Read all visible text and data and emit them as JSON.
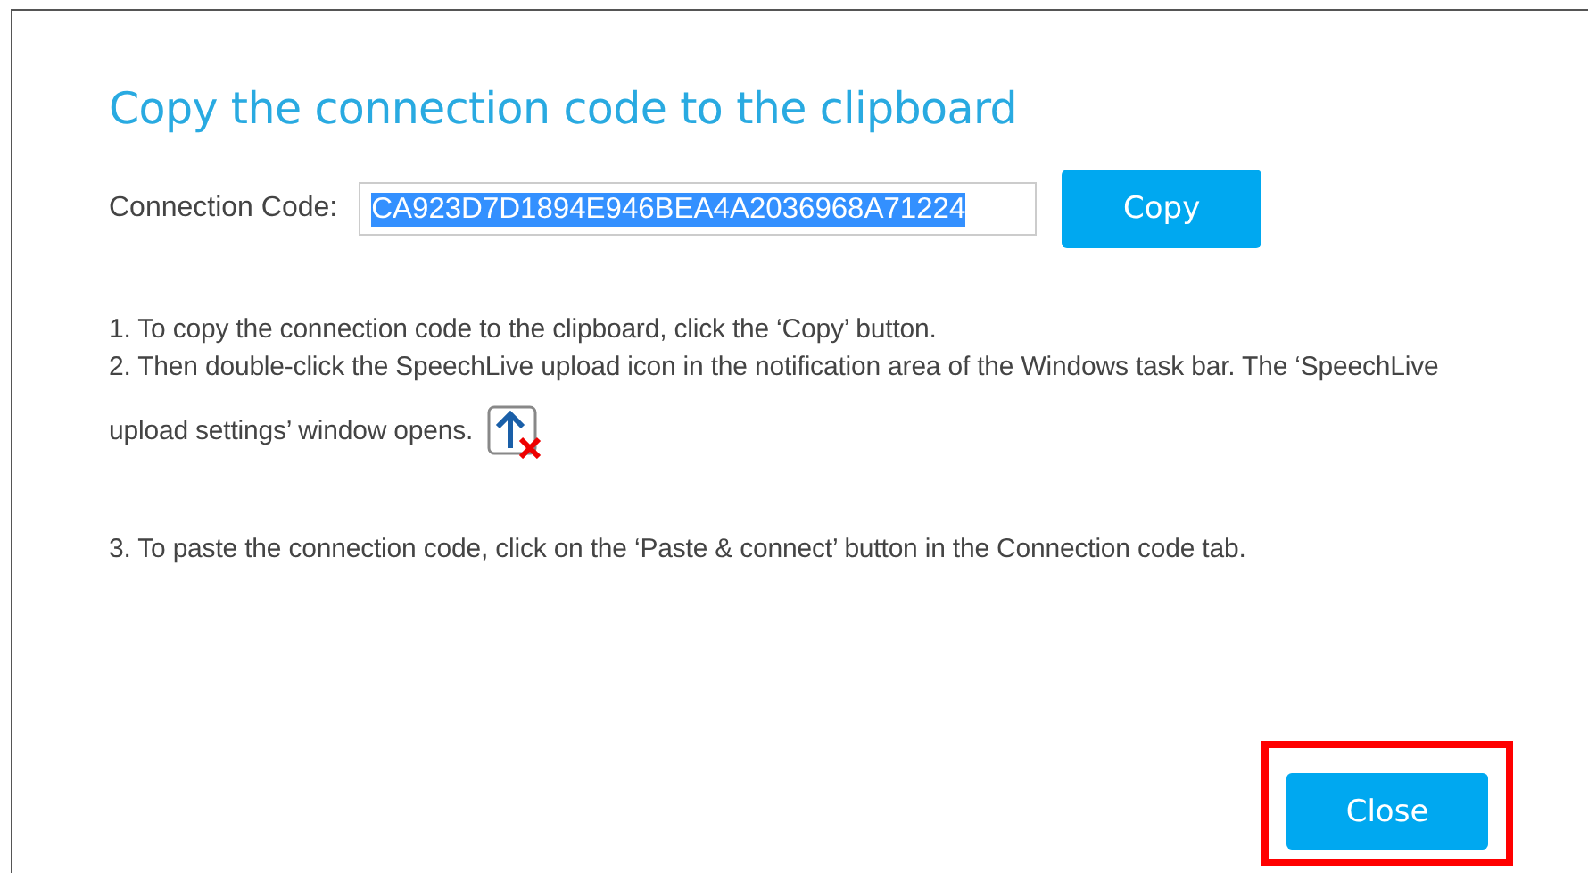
{
  "dialog": {
    "title": "Copy the connection code to the clipboard",
    "connection_code": {
      "label": "Connection Code:",
      "value": "CA923D7D1894E946BEA4A2036968A71224",
      "selected": true
    },
    "copy_button": "Copy",
    "steps": [
      {
        "text": "1. To copy the connection code to the clipboard, click the ‘Copy’ button."
      },
      {
        "text": "2. Then double-click the SpeechLive upload icon in the notification area of the Windows task bar. The ‘SpeechLive upload settings’ window opens.",
        "icon": true
      },
      {
        "text": "3. To paste the connection code, click on the ‘Paste & connect’ button in the Connection code tab."
      }
    ],
    "close_button": {
      "label": "Close",
      "highlighted": true
    }
  }
}
